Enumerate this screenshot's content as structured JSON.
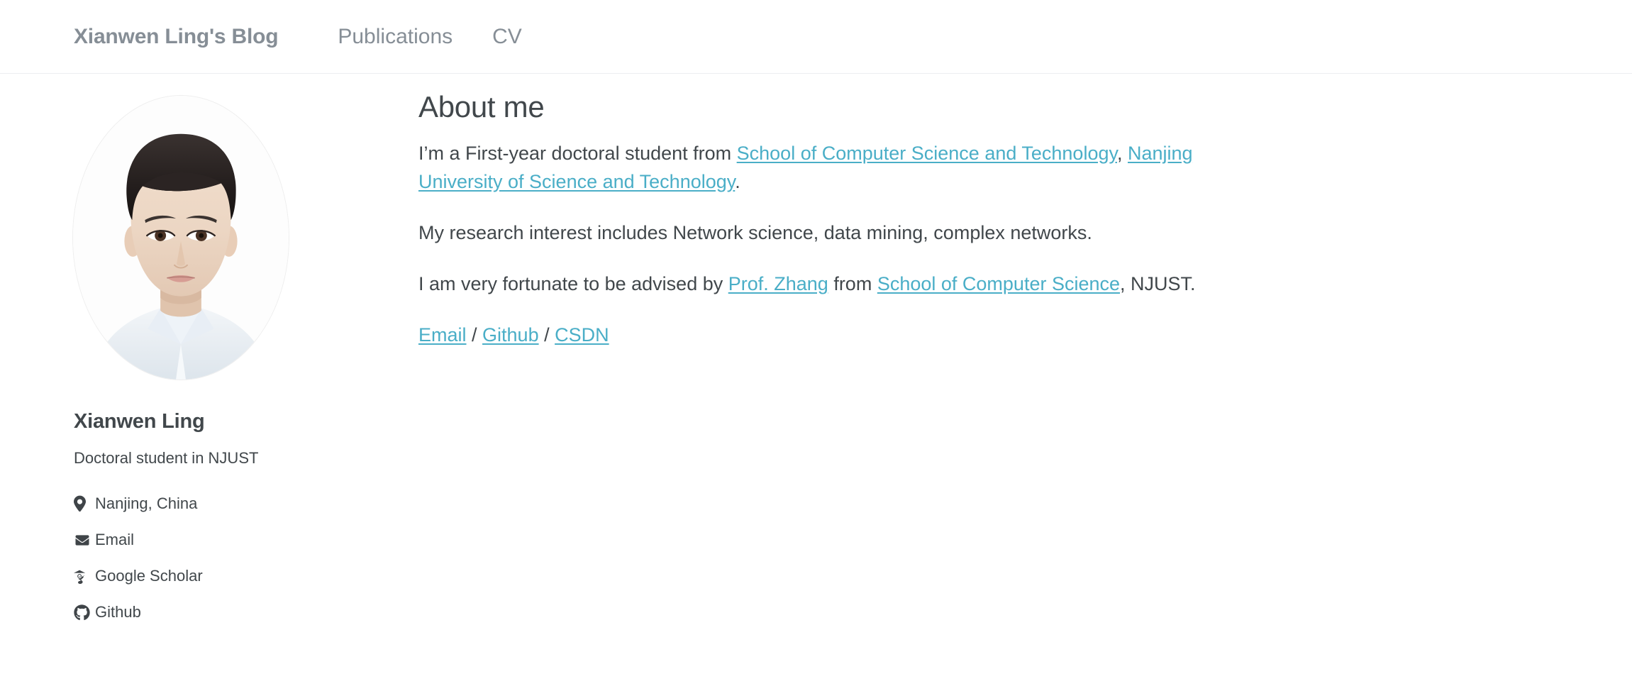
{
  "header": {
    "brand": "Xianwen Ling's Blog",
    "nav": [
      {
        "label": "Publications",
        "name": "nav-link-publications"
      },
      {
        "label": "CV",
        "name": "nav-link-cv"
      }
    ]
  },
  "sidebar": {
    "avatar_alt": "Portrait photo of Xianwen Ling",
    "name": "Xianwen Ling",
    "role": "Doctoral student in NJUST",
    "contacts": [
      {
        "icon": "location-pin-icon",
        "label": "Nanjing, China"
      },
      {
        "icon": "envelope-icon",
        "label": "Email"
      },
      {
        "icon": "google-scholar-icon",
        "label": "Google Scholar"
      },
      {
        "icon": "github-icon",
        "label": "Github"
      }
    ]
  },
  "main": {
    "title": "About me",
    "paragraph1": {
      "prefix": "I’m a First-year doctoral student from ",
      "link1": "School of Computer Science and Technology",
      "middle": ", ",
      "link2": "Nanjing University of Science and Technology",
      "suffix": "."
    },
    "paragraph2": "My research interest includes Network science, data mining, complex networks.",
    "paragraph3": {
      "prefix": "I am very fortunate to be advised by ",
      "link1": "Prof. Zhang",
      "middle": " from ",
      "link2": "School of Computer Science",
      "suffix": ", NJUST."
    },
    "links_line": {
      "link1": "Email",
      "sep1": " / ",
      "link2": "Github",
      "sep2": " / ",
      "link3": "CSDN"
    }
  },
  "colors": {
    "link": "#4aaec7",
    "text": "#41474b",
    "muted": "#868e96",
    "border": "#eceef0"
  }
}
